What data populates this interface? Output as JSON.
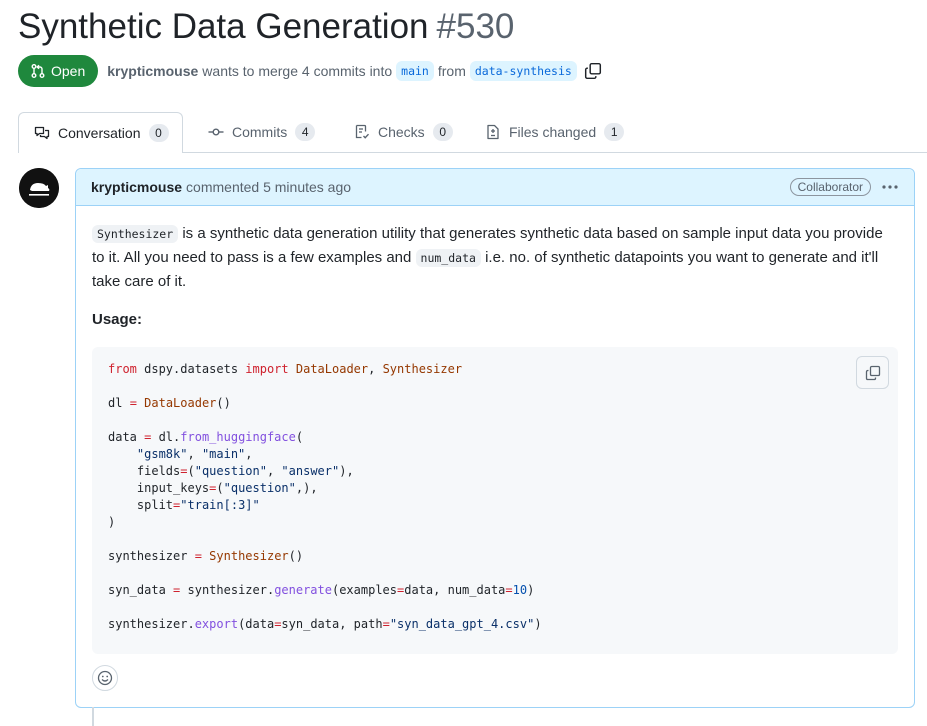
{
  "pr": {
    "title": "Synthetic Data Generation",
    "number": "#530",
    "state": "Open",
    "author": "krypticmouse",
    "merge_text": "wants to merge 4 commits into",
    "base_branch": "main",
    "from_text": "from",
    "head_branch": "data-synthesis"
  },
  "tabs": [
    {
      "label": "Conversation",
      "count": "0"
    },
    {
      "label": "Commits",
      "count": "4"
    },
    {
      "label": "Checks",
      "count": "0"
    },
    {
      "label": "Files changed",
      "count": "1"
    }
  ],
  "comment": {
    "author": "krypticmouse",
    "action": "commented 5 minutes ago",
    "role": "Collaborator",
    "body": {
      "code1": "Synthesizer",
      "text1": " is a synthetic data generation utility that generates synthetic data based on sample input data you provide to it. All you need to pass is a few examples and ",
      "code2": "num_data",
      "text2": " i.e. no. of synthetic datapoints you want to generate and it'll take care of it."
    },
    "usage_heading": "Usage:"
  },
  "code": {
    "l1": {
      "a": "from",
      "b": " dspy.datasets ",
      "c": "import",
      "d": " ",
      "e": "DataLoader",
      "f": ", ",
      "g": "Synthesizer"
    },
    "l3": {
      "a": "dl ",
      "b": "=",
      "c": " ",
      "d": "DataLoader",
      "e": "()"
    },
    "l5": {
      "a": "data ",
      "b": "=",
      "c": " dl.",
      "d": "from_huggingface",
      "e": "("
    },
    "l6": {
      "a": "    ",
      "b": "\"gsm8k\"",
      "c": ", ",
      "d": "\"main\"",
      "e": ","
    },
    "l7": {
      "a": "    fields",
      "b": "=",
      "c": "(",
      "d": "\"question\"",
      "e": ", ",
      "f": "\"answer\"",
      "g": "),"
    },
    "l8": {
      "a": "    input_keys",
      "b": "=",
      "c": "(",
      "d": "\"question\"",
      "e": ",),"
    },
    "l9": {
      "a": "    split",
      "b": "=",
      "c": "\"train[:3]\""
    },
    "l10": {
      "a": ")"
    },
    "l12": {
      "a": "synthesizer ",
      "b": "=",
      "c": " ",
      "d": "Synthesizer",
      "e": "()"
    },
    "l14": {
      "a": "syn_data ",
      "b": "=",
      "c": " synthesizer.",
      "d": "generate",
      "e": "(examples",
      "f": "=",
      "g": "data, num_data",
      "h": "=",
      "i": "10",
      "j": ")"
    },
    "l16": {
      "a": "synthesizer.",
      "b": "export",
      "c": "(data",
      "d": "=",
      "e": "syn_data, path",
      "f": "=",
      "g": "\"syn_data_gpt_4.csv\"",
      "h": ")"
    }
  },
  "colors": {
    "open_green": "#1f883d",
    "branch_blue": "#0969da",
    "header_blue": "#ddf4ff",
    "border_blue": "#9cd2f7"
  }
}
